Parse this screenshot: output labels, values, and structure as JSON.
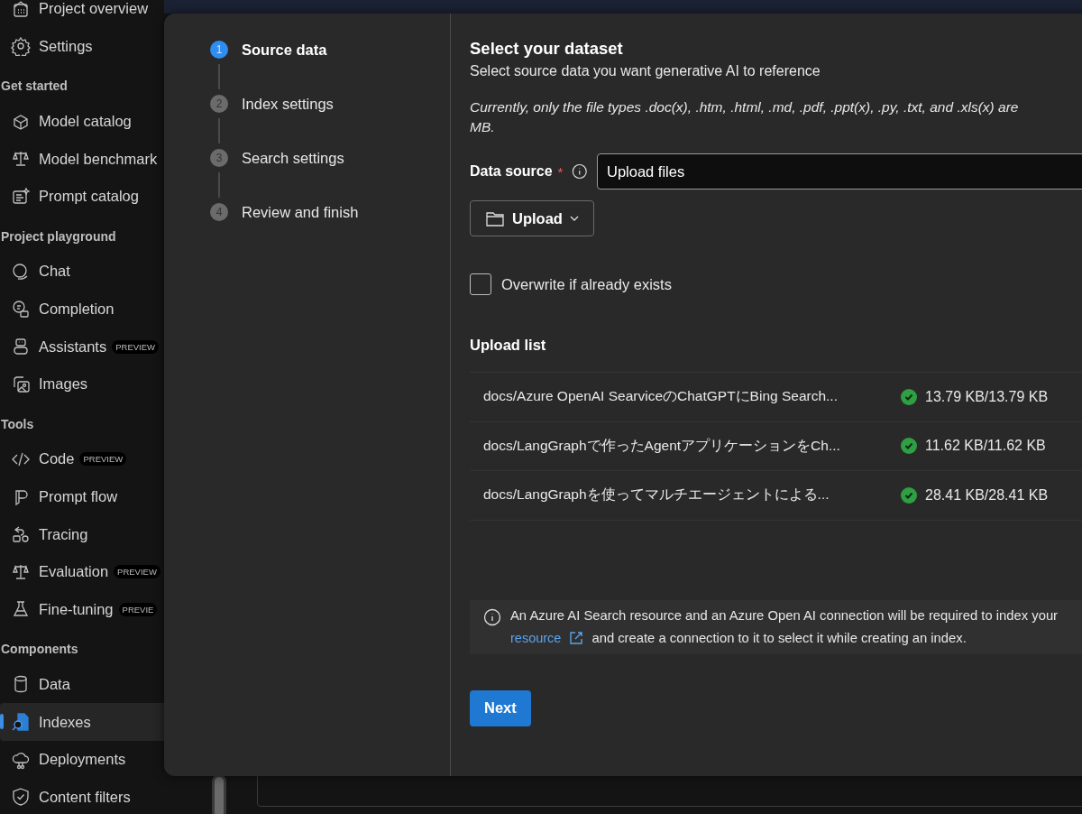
{
  "sidebar": {
    "sections": [
      {
        "items": [
          {
            "label": "Project overview",
            "selected": false
          },
          {
            "label": "Settings",
            "selected": false
          }
        ]
      },
      {
        "heading": "Get started",
        "items": [
          {
            "label": "Model catalog",
            "selected": false
          },
          {
            "label": "Model benchmark",
            "selected": false
          },
          {
            "label": "Prompt catalog",
            "selected": false
          }
        ]
      },
      {
        "heading": "Project playground",
        "items": [
          {
            "label": "Chat",
            "selected": false
          },
          {
            "label": "Completion",
            "selected": false
          },
          {
            "label": "Assistants",
            "badge": "PREVIEW",
            "selected": false
          },
          {
            "label": "Images",
            "selected": false
          }
        ]
      },
      {
        "heading": "Tools",
        "items": [
          {
            "label": "Code",
            "badge": "PREVIEW",
            "selected": false
          },
          {
            "label": "Prompt flow",
            "selected": false
          },
          {
            "label": "Tracing",
            "selected": false
          },
          {
            "label": "Evaluation",
            "badge": "PREVIEW",
            "selected": false
          },
          {
            "label": "Fine-tuning",
            "badge": "PREVIE",
            "selected": false
          }
        ]
      },
      {
        "heading": "Components",
        "items": [
          {
            "label": "Data",
            "selected": false
          },
          {
            "label": "Indexes",
            "selected": true
          },
          {
            "label": "Deployments",
            "selected": false
          },
          {
            "label": "Content filters",
            "selected": false
          }
        ]
      }
    ]
  },
  "wizard": {
    "steps": [
      {
        "number": "1",
        "label": "Source data",
        "selected": true
      },
      {
        "number": "2",
        "label": "Index settings",
        "selected": false
      },
      {
        "number": "3",
        "label": "Search settings",
        "selected": false
      },
      {
        "number": "4",
        "label": "Review and finish",
        "selected": false
      }
    ],
    "title": "Select your dataset",
    "subtitle": "Select source data you want generative AI to reference",
    "note_lines": [
      "Currently, only the file types .doc(x), .htm, .html, .md, .pdf, .ppt(x), .py, .txt, and .xls(x) are",
      "MB."
    ],
    "data_source": {
      "label": "Data source",
      "required_mark": "*",
      "value": "Upload files"
    },
    "upload_button": "Upload",
    "overwrite": {
      "label": "Overwrite if already exists",
      "checked": false
    },
    "upload_list": {
      "heading": "Upload list",
      "files": [
        {
          "name": "docs/Azure OpenAI SearviceのChatGPTにBing Search...",
          "color": "#2ea043",
          "size": "13.79 KB/13.79 KB"
        },
        {
          "name": "docs/LangGraphで作ったAgentアプリケーションをCh...",
          "color": "#2ea043",
          "size": "11.62 KB/11.62 KB"
        },
        {
          "name": "docs/LangGraphを使ってマルチエージェントによる...",
          "color": "#2ea043",
          "size": "28.41 KB/28.41 KB"
        }
      ]
    },
    "info": {
      "line_1": "An Azure AI Search resource and an Azure Open AI connection will be required to index your",
      "link": "resource",
      "line_2": "and create a connection to it to select it while creating an index."
    },
    "next_button": "Next"
  }
}
